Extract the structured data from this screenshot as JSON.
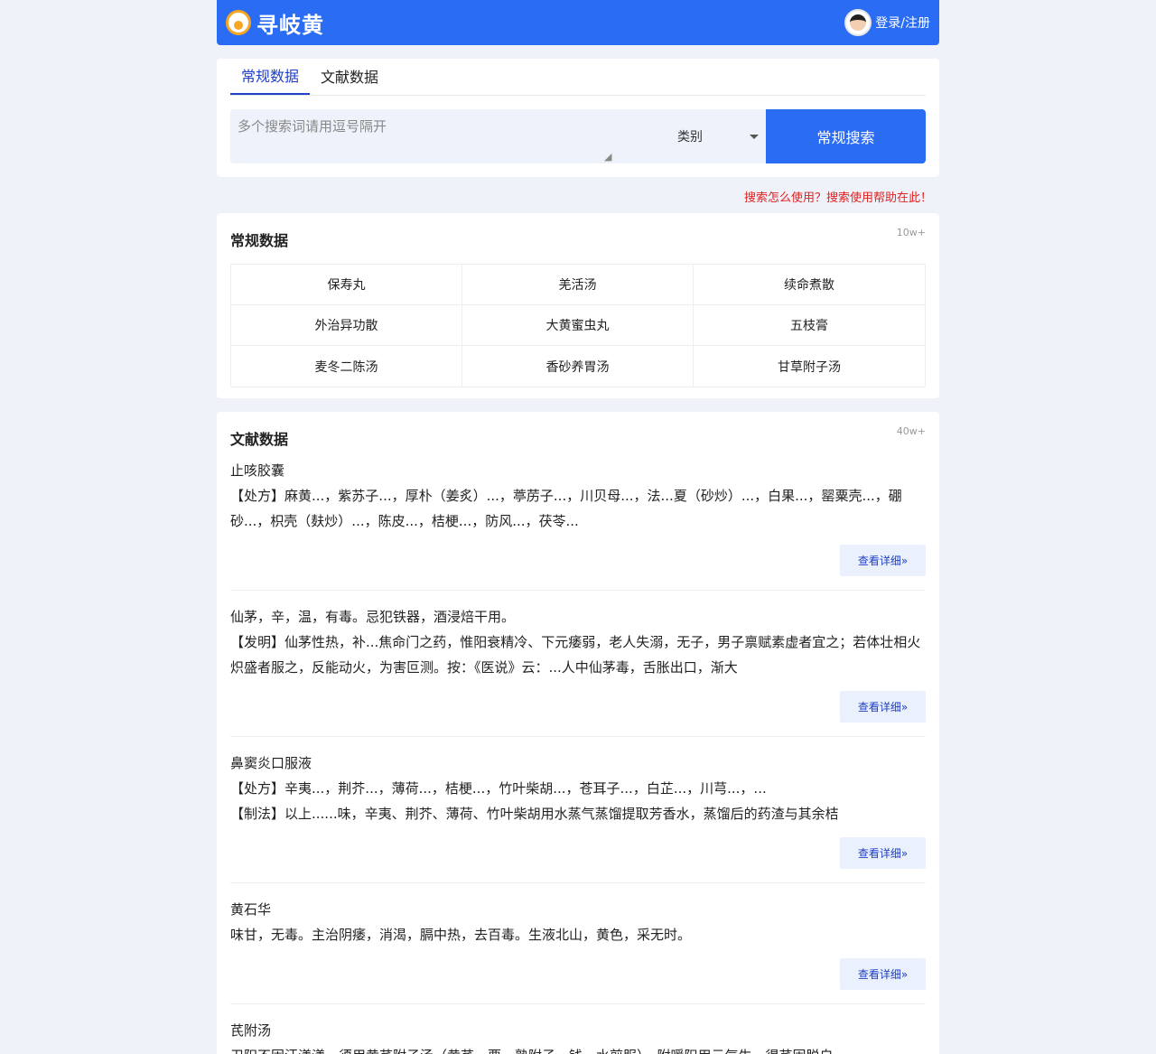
{
  "header": {
    "brand": "寻岐黄",
    "login": "登录/注册"
  },
  "search": {
    "tabs": [
      "常规数据",
      "文献数据"
    ],
    "placeholder": "多个搜索词请用逗号隔开",
    "category": "类别",
    "button": "常规搜索",
    "help": "搜索怎么使用？搜索使用帮助在此！"
  },
  "regular": {
    "title": "常规数据",
    "count": "10w+",
    "items": [
      "保寿丸",
      "羌活汤",
      "续命煮散",
      "外治异功散",
      "大黄蜜虫丸",
      "五枝膏",
      "麦冬二陈汤",
      "香砂养胃汤",
      "甘草附子汤"
    ]
  },
  "literature": {
    "title": "文献数据",
    "count": "40w+",
    "detail_label": "查看详细",
    "items": [
      {
        "title": "止咳胶囊",
        "lines": [
          "【处方】麻黄...，紫苏子...，厚朴（姜炙）...，葶苈子...，川贝母...，法...夏（砂炒）...，白果...，罂粟壳...，硼砂...，枳壳（麸炒）...，陈皮...，桔梗...，防风...，茯苓..."
        ]
      },
      {
        "title": "仙茅，辛，温，有毒。忌犯铁器，酒浸焙干用。",
        "lines": [
          "【发明】仙茅性热，补...焦命门之药，惟阳衰精冷、下元痿弱，老人失溺，无子，男子禀赋素虚者宜之；若体壮相火炽盛者服之，反能动火，为害叵测。按：《医说》云：...人中仙茅毒，舌胀出口，渐大"
        ]
      },
      {
        "title": "鼻窦炎口服液",
        "lines": [
          "【处方】辛夷...，荆芥...，薄荷...，桔梗...，竹叶柴胡...，苍耳子...，白芷...，川芎...，...",
          "【制法】以上......味，辛夷、荆芥、薄荷、竹叶柴胡用水蒸气蒸馏提取芳香水，蒸馏后的药渣与其余桔"
        ]
      },
      {
        "title": "黄石华",
        "lines": [
          "味甘，无毒。主治阴痿，消渴，膈中热，去百毒。生液北山，黄色，采无时。"
        ]
      },
      {
        "title": "芪附汤",
        "lines": [
          "卫阳不固汗漾漾，须用黄芪附子汤（黄芪、栗、熟附子、钱，水煎服），附暖阳用云气生，得芪固脱自"
        ]
      }
    ]
  }
}
